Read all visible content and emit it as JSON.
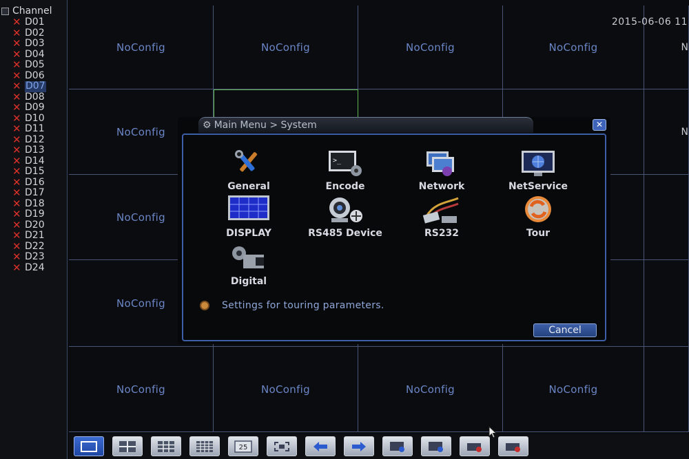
{
  "channel_panel": {
    "header": "Channel",
    "channels": [
      "D01",
      "D02",
      "D03",
      "D04",
      "D05",
      "D06",
      "D07",
      "D08",
      "D09",
      "D10",
      "D11",
      "D12",
      "D13",
      "D14",
      "D15",
      "D16",
      "D17",
      "D18",
      "D19",
      "D20",
      "D21",
      "D22",
      "D23",
      "D24"
    ],
    "selected": "D07"
  },
  "timestamp": "2015-06-06 11",
  "grid": {
    "cell_label": "NoConfig",
    "right_edge_mark": "N"
  },
  "dialog": {
    "title": "Main Menu > System",
    "close_label": "✕",
    "items": [
      {
        "label": "General",
        "icon": "wrench-screwdriver-icon"
      },
      {
        "label": "Encode",
        "icon": "terminal-gear-icon"
      },
      {
        "label": "Network",
        "icon": "network-monitors-icon"
      },
      {
        "label": "NetService",
        "icon": "globe-monitor-icon"
      },
      {
        "label": "DISPLAY",
        "icon": "display-grid-icon"
      },
      {
        "label": "RS485 Device",
        "icon": "ptz-camera-icon"
      },
      {
        "label": "RS232",
        "icon": "serial-cable-icon"
      },
      {
        "label": "Tour",
        "icon": "tour-cycle-icon"
      },
      {
        "label": "Digital",
        "icon": "digital-camera-gear-icon"
      }
    ],
    "info_text": "Settings for touring parameters.",
    "cancel_label": "Cancel"
  },
  "toolbar": {
    "buttons": [
      {
        "name": "single-view",
        "icon": "single-screen-icon",
        "active": true
      },
      {
        "name": "quad-view",
        "icon": "quad-screen-icon"
      },
      {
        "name": "nine-view",
        "icon": "nine-screen-icon"
      },
      {
        "name": "sixteen-view",
        "icon": "sixteen-screen-icon"
      },
      {
        "name": "twentyfive-view",
        "icon": "twenty-five-screen-icon",
        "text": "25"
      },
      {
        "name": "fullscreen",
        "icon": "fullscreen-icon"
      },
      {
        "name": "previous",
        "icon": "arrow-left-icon"
      },
      {
        "name": "next",
        "icon": "arrow-right-icon"
      },
      {
        "name": "playback",
        "icon": "playback-icon"
      },
      {
        "name": "ptz",
        "icon": "ptz-icon"
      },
      {
        "name": "record",
        "icon": "record-icon"
      },
      {
        "name": "stop-record",
        "icon": "stop-record-icon"
      }
    ]
  },
  "colors": {
    "accent": "#3c5fa8",
    "alarm_x": "#d8312b",
    "noconfig_text": "#6b86c7",
    "active_cell": "#5fb84b"
  }
}
